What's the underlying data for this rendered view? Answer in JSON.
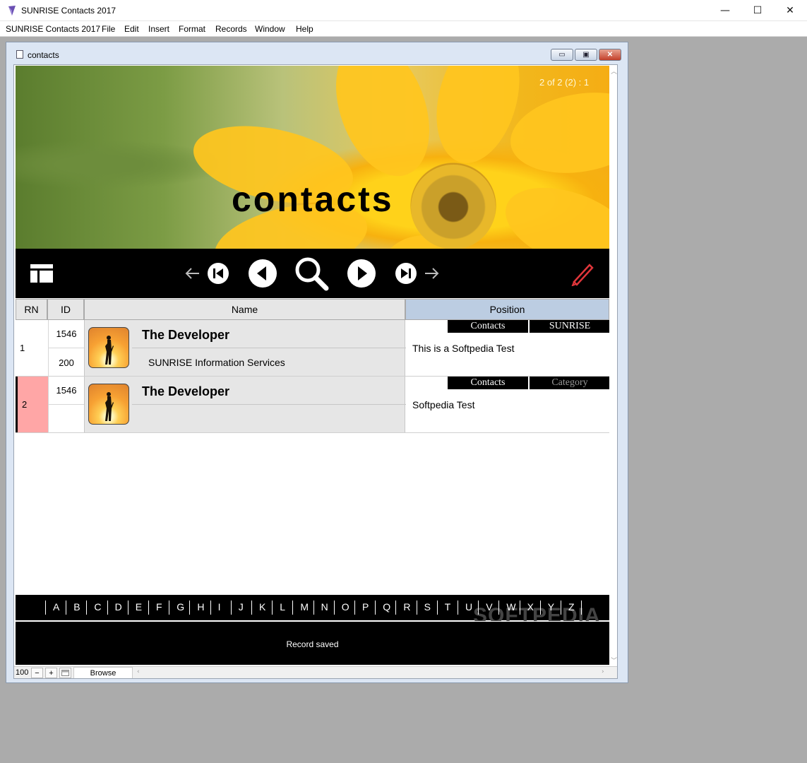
{
  "app": {
    "title": "SUNRISE Contacts 2017",
    "window_buttons": {
      "minimize": "—",
      "maximize": "☐",
      "close": "✕"
    }
  },
  "menu": [
    "SUNRISE Contacts 2017",
    "File",
    "Edit",
    "Insert",
    "Format",
    "Records",
    "Window",
    "Help"
  ],
  "child_window": {
    "title": "contacts",
    "buttons": {
      "minimize": "▭",
      "restore": "▣",
      "close": "✕"
    }
  },
  "header": {
    "title": "contacts",
    "record_counter": "2 of 2 (2) : 1"
  },
  "toolbar": {
    "icons": [
      "layout-icon",
      "arrow-left-icon",
      "first-record-icon",
      "previous-record-icon",
      "search-icon",
      "next-record-icon",
      "last-record-icon",
      "arrow-right-icon",
      "edit-pencil-icon"
    ],
    "edit_color": "#e0363b"
  },
  "table": {
    "headers": {
      "rn": "RN",
      "id": "ID",
      "name": "Name",
      "position": "Position"
    },
    "rows": [
      {
        "rn": "1",
        "id": "1546",
        "id2": "200",
        "name": "The Developer",
        "company": "SUNRISE Information Services",
        "tags": [
          "Contacts",
          "SUNRISE"
        ],
        "position_text": "This is a Softpedia Test",
        "selected": false
      },
      {
        "rn": "2",
        "id": "1546",
        "id2": "",
        "name": "The Developer",
        "company": "",
        "tags": [
          "Contacts",
          "Category"
        ],
        "position_text": "Softpedia Test",
        "selected": true
      }
    ],
    "selected_row_color": "#ffa6a6"
  },
  "alphabet": [
    "A",
    "B",
    "C",
    "D",
    "E",
    "F",
    "G",
    "H",
    "I",
    "J",
    "K",
    "L",
    "M",
    "N",
    "O",
    "P",
    "Q",
    "R",
    "S",
    "T",
    "U",
    "V",
    "W",
    "X",
    "Y",
    "Z"
  ],
  "watermark": "SOFTPEDIA",
  "status": "Record saved",
  "bottombar": {
    "zoom": "100",
    "zoom_out": "−",
    "zoom_in": "+",
    "mode": "Browse"
  }
}
